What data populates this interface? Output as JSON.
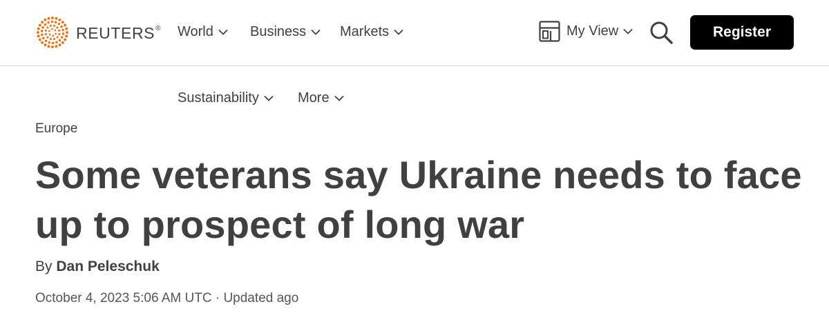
{
  "brand": {
    "name": "REUTERS",
    "registered_mark": "®",
    "logo_color": "#f56a00"
  },
  "nav": {
    "items": [
      {
        "label": "World",
        "icon": "chevron-down-icon"
      },
      {
        "label": "Business",
        "icon": "chevron-down-icon"
      },
      {
        "label": "Markets",
        "icon": "chevron-down-icon"
      },
      {
        "label": "Sustainability",
        "icon": "chevron-down-icon"
      },
      {
        "label": "More",
        "icon": "chevron-down-icon"
      }
    ]
  },
  "header_actions": {
    "myview_label": "My View",
    "myview_icon": "layout-icon",
    "search_icon": "search-icon",
    "register_label": "Register"
  },
  "article": {
    "section": "Europe",
    "headline": "Some veterans say Ukraine needs to face up to prospect of long war",
    "byline_prefix": "By",
    "author": "Dan Peleschuk",
    "dateline": "October 4, 2023 5:06 AM UTC · Updated ago"
  },
  "colors": {
    "text": "#404040",
    "register_bg": "#000000",
    "register_text": "#ffffff",
    "divider": "#d4d4d4"
  }
}
